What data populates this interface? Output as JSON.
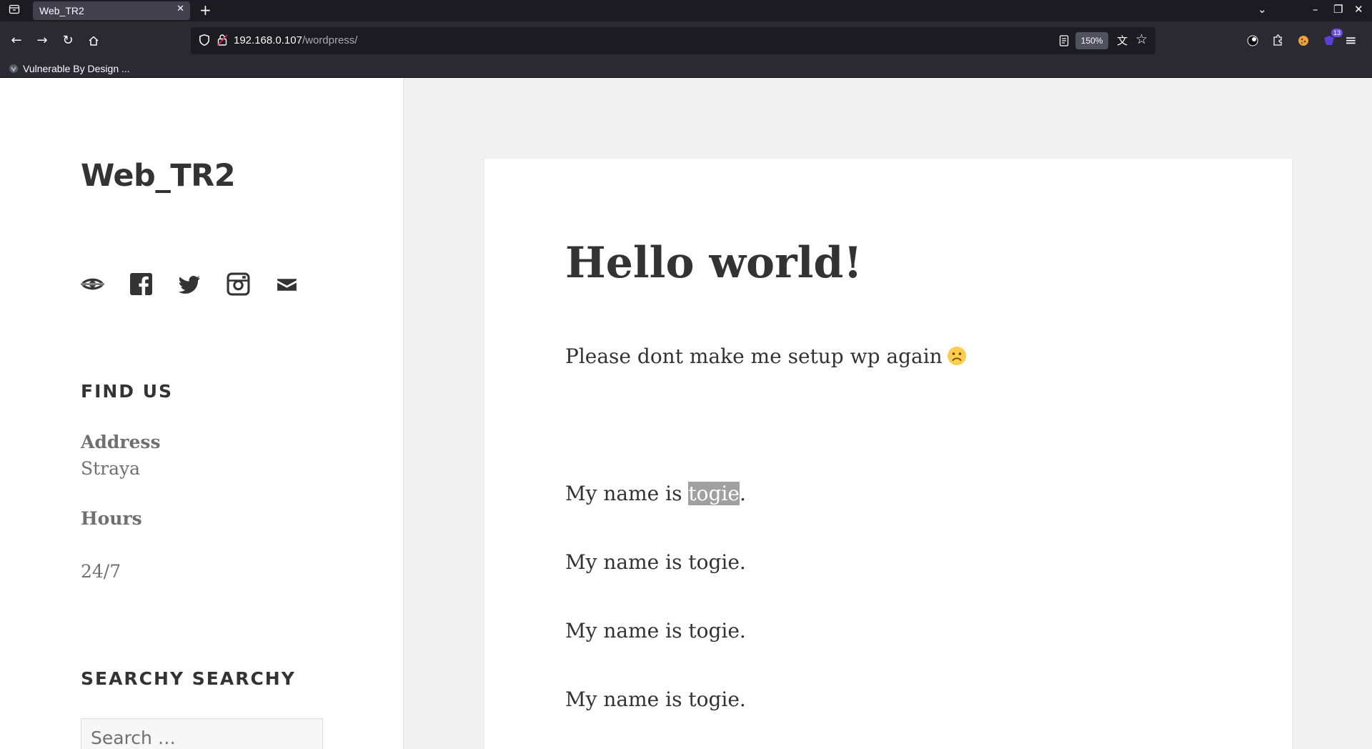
{
  "browser": {
    "tab_title": "Web_TR2",
    "url_host": "192.168.0.107",
    "url_path": "/wordpress/",
    "zoom": "150%",
    "extension_badge": "13",
    "bookmark_label": "Vulnerable By Design ..."
  },
  "sidebar": {
    "site_title": "Web_TR2",
    "social_icons": [
      "wordpress-icon",
      "facebook-icon",
      "twitter-icon",
      "instagram-icon",
      "email-icon"
    ],
    "find_us_title": "FIND US",
    "address_label": "Address",
    "address_value": "Straya",
    "hours_label": "Hours",
    "hours_value": "24/7",
    "search_title": "SEARCHY SEARCHY",
    "search_placeholder": "Search …"
  },
  "post": {
    "title": "Hello world!",
    "intro": "Please dont make me setup wp again",
    "emoji": "slightly-frowning-face",
    "name_prefix": "My name is ",
    "name_highlight": "togie",
    "name_suffix": ".",
    "lines": [
      "My name is togie.",
      "My name is togie.",
      "My name is togie."
    ]
  },
  "colors": {
    "chrome_dark": "#1c1b22",
    "chrome": "#2b2a33",
    "text": "#333333",
    "muted": "#707070",
    "highlight": "#a0a0a0"
  }
}
